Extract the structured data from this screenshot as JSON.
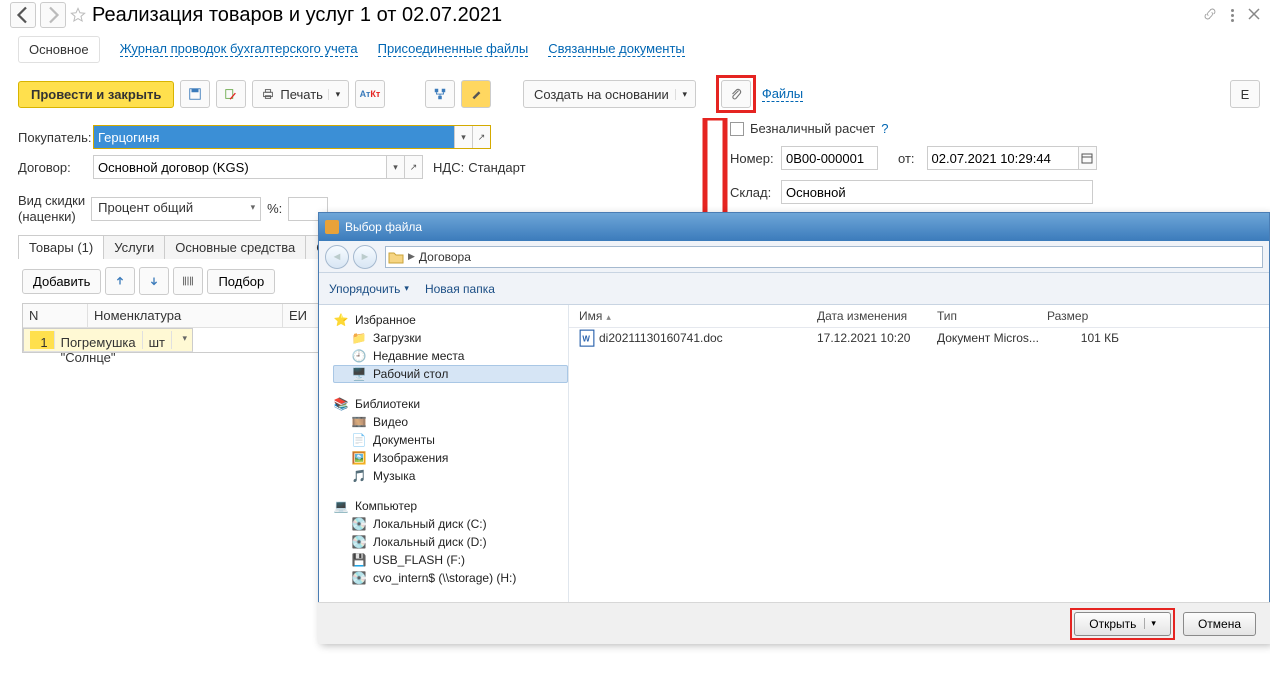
{
  "title": "Реализация товаров и услуг 1 от 02.07.2021",
  "linkrow": {
    "current": "Основное",
    "links": [
      "Журнал проводок бухгалтерского учета",
      "Присоединенные файлы",
      "Связанные документы"
    ]
  },
  "toolbar": {
    "post_close": "Провести и закрыть",
    "print": "Печать",
    "create_based": "Создать на основании",
    "files_link": "Файлы",
    "more": "Е"
  },
  "form": {
    "buyer_label": "Покупатель:",
    "buyer_value": "Герцогиня",
    "contract_label": "Договор:",
    "contract_value": "Основной договор (KGS)",
    "vat_label": "НДС:",
    "vat_value": "Стандарт",
    "cashless_label": "Безналичный расчет",
    "number_label": "Номер:",
    "number_value": "0В00-000001",
    "date_label": "от:",
    "date_value": "02.07.2021 10:29:44",
    "warehouse_label": "Склад:",
    "warehouse_value": "Основной"
  },
  "discount": {
    "label1": "Вид скидки",
    "label2": "(наценки)",
    "value": "Процент общий",
    "pct_label": "%:"
  },
  "tabs": {
    "t1": "Товары (1)",
    "t2": "Услуги",
    "t3": "Основные средства",
    "t4": "С"
  },
  "tab_toolbar": {
    "add": "Добавить",
    "select": "Подбор"
  },
  "grid": {
    "h_n": "N",
    "h_name": "Номенклатура",
    "h_unit": "ЕИ",
    "r1_n": "1",
    "r1_name": "Погремушка \"Солнце\"",
    "r1_unit": "шт"
  },
  "dialog": {
    "title": "Выбор файла",
    "breadcrumb": "Договора",
    "organize": "Упорядочить",
    "new_folder": "Новая папка",
    "fav": "Избранное",
    "downloads": "Загрузки",
    "recent": "Недавние места",
    "desktop": "Рабочий стол",
    "lib": "Библиотеки",
    "video": "Видео",
    "docs": "Документы",
    "images": "Изображения",
    "music": "Музыка",
    "computer": "Компьютер",
    "drive_c": "Локальный диск (C:)",
    "drive_d": "Локальный диск (D:)",
    "drive_f": "USB_FLASH (F:)",
    "drive_h": "cvo_intern$ (\\\\storage) (H:)",
    "col_name": "Имя",
    "col_date": "Дата изменения",
    "col_type": "Тип",
    "col_size": "Размер",
    "file_name": "di20211130160741.doc",
    "file_date": "17.12.2021 10:20",
    "file_type": "Документ Micros...",
    "file_size": "101 КБ",
    "open": "Открыть",
    "cancel": "Отмена"
  }
}
